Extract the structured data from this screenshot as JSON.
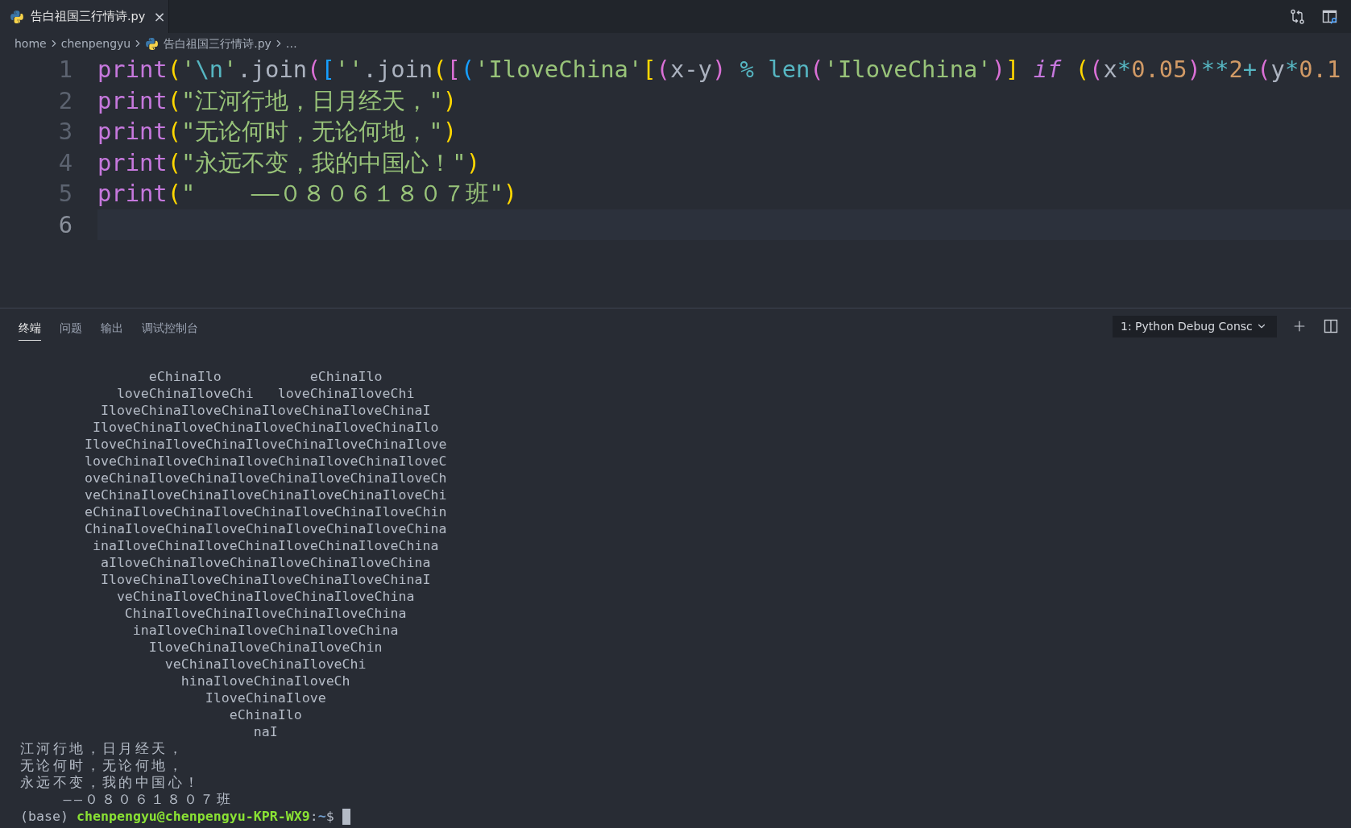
{
  "editor_tab": {
    "title": "告白祖国三行情诗.py",
    "close": "×"
  },
  "breadcrumb": [
    {
      "label": "home",
      "kind": "folder"
    },
    {
      "label": "chenpengyu",
      "kind": "folder"
    },
    {
      "label": "告白祖国三行情诗.py",
      "kind": "python"
    },
    {
      "label": "…",
      "kind": "more"
    }
  ],
  "code_lines": [
    {
      "number": "1",
      "current": false,
      "tokens": [
        {
          "text": "print",
          "kind": "function"
        },
        {
          "text": "(",
          "kind": "bracket1"
        },
        {
          "text": "'",
          "kind": "string"
        },
        {
          "text": "\\n",
          "kind": "escape"
        },
        {
          "text": "'",
          "kind": "string"
        },
        {
          "text": ".join",
          "kind": "plain"
        },
        {
          "text": "(",
          "kind": "bracket2"
        },
        {
          "text": "[",
          "kind": "bracket3"
        },
        {
          "text": "''",
          "kind": "string"
        },
        {
          "text": ".join",
          "kind": "plain"
        },
        {
          "text": "(",
          "kind": "bracket1"
        },
        {
          "text": "[",
          "kind": "bracket2"
        },
        {
          "text": "(",
          "kind": "bracket3"
        },
        {
          "text": "'IloveChina'",
          "kind": "string"
        },
        {
          "text": "[",
          "kind": "bracket1"
        },
        {
          "text": "(",
          "kind": "bracket2"
        },
        {
          "text": "x-y",
          "kind": "plain"
        },
        {
          "text": ")",
          "kind": "bracket2"
        },
        {
          "text": " % ",
          "kind": "operator"
        },
        {
          "text": "len",
          "kind": "builtin"
        },
        {
          "text": "(",
          "kind": "bracket2"
        },
        {
          "text": "'IloveChina'",
          "kind": "string"
        },
        {
          "text": ")",
          "kind": "bracket2"
        },
        {
          "text": "]",
          "kind": "bracket1"
        },
        {
          "text": " if ",
          "kind": "keyword"
        },
        {
          "text": "(",
          "kind": "bracket1"
        },
        {
          "text": "(",
          "kind": "bracket2"
        },
        {
          "text": "x",
          "kind": "plain"
        },
        {
          "text": "*",
          "kind": "operator"
        },
        {
          "text": "0.05",
          "kind": "number"
        },
        {
          "text": ")",
          "kind": "bracket2"
        },
        {
          "text": "**",
          "kind": "operator"
        },
        {
          "text": "2",
          "kind": "number"
        },
        {
          "text": "+",
          "kind": "operator"
        },
        {
          "text": "(",
          "kind": "bracket2"
        },
        {
          "text": "y",
          "kind": "plain"
        },
        {
          "text": "*",
          "kind": "operator"
        },
        {
          "text": "0.1",
          "kind": "number"
        }
      ]
    },
    {
      "number": "2",
      "current": false,
      "tokens": [
        {
          "text": "print",
          "kind": "function"
        },
        {
          "text": "(",
          "kind": "bracket1"
        },
        {
          "text": "\"江河行地，日月经天，\"",
          "kind": "string"
        },
        {
          "text": ")",
          "kind": "bracket1"
        }
      ]
    },
    {
      "number": "3",
      "current": false,
      "tokens": [
        {
          "text": "print",
          "kind": "function"
        },
        {
          "text": "(",
          "kind": "bracket1"
        },
        {
          "text": "\"无论何时，无论何地，\"",
          "kind": "string"
        },
        {
          "text": ")",
          "kind": "bracket1"
        }
      ]
    },
    {
      "number": "4",
      "current": false,
      "tokens": [
        {
          "text": "print",
          "kind": "function"
        },
        {
          "text": "(",
          "kind": "bracket1"
        },
        {
          "text": "\"永远不变，我的中国心！\"",
          "kind": "string"
        },
        {
          "text": ")",
          "kind": "bracket1"
        }
      ]
    },
    {
      "number": "5",
      "current": false,
      "tokens": [
        {
          "text": "print",
          "kind": "function"
        },
        {
          "text": "(",
          "kind": "bracket1"
        },
        {
          "text": "\"    ——０８０６１８０７班\"",
          "kind": "string"
        },
        {
          "text": ")",
          "kind": "bracket1"
        }
      ]
    },
    {
      "number": "6",
      "current": true
    }
  ],
  "panel_tabs": [
    {
      "label": "终端",
      "selected": true
    },
    {
      "label": "问题",
      "selected": false
    },
    {
      "label": "输出",
      "selected": false
    },
    {
      "label": "调试控制台",
      "selected": false
    }
  ],
  "terminal_select": {
    "value": "1: Python Debug Consc"
  },
  "terminal_output": [
    {
      "text": "                eChinaIlo           eChinaIlo",
      "kind": "ascii"
    },
    {
      "text": "            loveChinaIloveChi   loveChinaIloveChi",
      "kind": "ascii"
    },
    {
      "text": "          IloveChinaIloveChinaIloveChinaIloveChinaI",
      "kind": "ascii"
    },
    {
      "text": "         IloveChinaIloveChinaIloveChinaIloveChinaIlo",
      "kind": "ascii"
    },
    {
      "text": "        IloveChinaIloveChinaIloveChinaIloveChinaIlove",
      "kind": "ascii"
    },
    {
      "text": "        loveChinaIloveChinaIloveChinaIloveChinaIloveC",
      "kind": "ascii"
    },
    {
      "text": "        oveChinaIloveChinaIloveChinaIloveChinaIloveCh",
      "kind": "ascii"
    },
    {
      "text": "        veChinaIloveChinaIloveChinaIloveChinaIloveChi",
      "kind": "ascii"
    },
    {
      "text": "        eChinaIloveChinaIloveChinaIloveChinaIloveChin",
      "kind": "ascii"
    },
    {
      "text": "        ChinaIloveChinaIloveChinaIloveChinaIloveChina",
      "kind": "ascii"
    },
    {
      "text": "         inaIloveChinaIloveChinaIloveChinaIloveChina",
      "kind": "ascii"
    },
    {
      "text": "          aIloveChinaIloveChinaIloveChinaIloveChina",
      "kind": "ascii"
    },
    {
      "text": "          IloveChinaIloveChinaIloveChinaIloveChinaI",
      "kind": "ascii"
    },
    {
      "text": "            veChinaIloveChinaIloveChinaIloveChina",
      "kind": "ascii"
    },
    {
      "text": "             ChinaIloveChinaIloveChinaIloveChina",
      "kind": "ascii"
    },
    {
      "text": "              inaIloveChinaIloveChinaIloveChina",
      "kind": "ascii"
    },
    {
      "text": "                IloveChinaIloveChinaIloveChin",
      "kind": "ascii"
    },
    {
      "text": "                  veChinaIloveChinaIloveChi",
      "kind": "ascii"
    },
    {
      "text": "                    hinaIloveChinaIloveCh",
      "kind": "ascii"
    },
    {
      "text": "                       IloveChinaIlove",
      "kind": "ascii"
    },
    {
      "text": "                          eChinaIlo",
      "kind": "ascii"
    },
    {
      "text": "                             naI",
      "kind": "ascii"
    },
    {
      "text": "江河行地，日月经天，",
      "kind": "wide"
    },
    {
      "text": "无论何时，无论何地，",
      "kind": "wide"
    },
    {
      "text": "永远不变，我的中国心！",
      "kind": "wide"
    },
    {
      "text": "    ——０８０６１８０７班",
      "kind": "wide"
    }
  ],
  "prompt": {
    "env": "(base)",
    "user_host": "chenpengyu@chenpengyu-KPR-WX9",
    "separator": ":",
    "path": "~",
    "symbol": "$"
  }
}
